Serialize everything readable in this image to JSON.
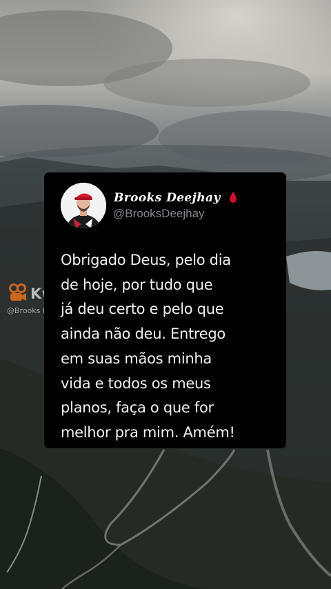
{
  "tweet": {
    "display_name": "Brooks Deejhay",
    "handle": "@BrooksDeejhay",
    "text": "Obrigado Deus, pelo dia\nde hoje, por tudo que\njá deu certo e pelo que\nainda não deu. Entrego\nem suas mãos minha\nvida e todos os meus\nplanos, faça o que for\nmelhor pra mim. Amém!",
    "name_icon": "blood-drop-icon"
  },
  "watermark": {
    "brand": "Kwai",
    "handle": "@Brooks Deejhay",
    "icon": "kwai-logo-icon"
  },
  "colors": {
    "card_background": "#000000",
    "text": "#eff2f4",
    "handle": "#7f878d",
    "drop": "#c8102e",
    "watermark_logo": "#ff7a1a"
  }
}
